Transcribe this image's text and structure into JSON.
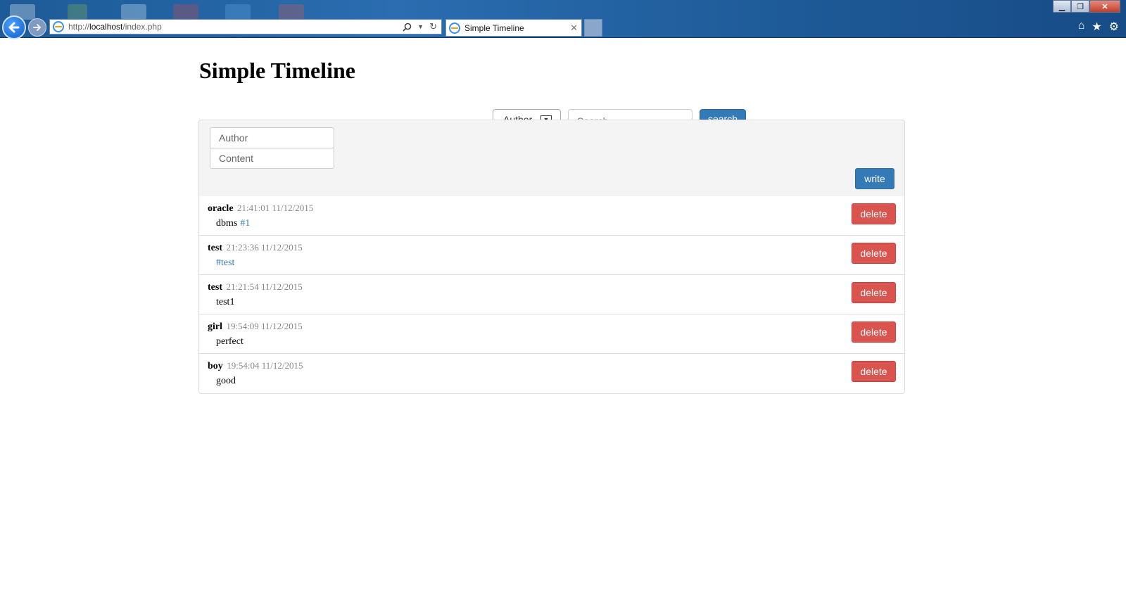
{
  "browser": {
    "url_prefix": "http://",
    "url_host": "localhost",
    "url_path": "/index.php",
    "tab_title": "Simple Timeline"
  },
  "page": {
    "title": "Simple Timeline"
  },
  "search": {
    "filter_selected": "Author",
    "placeholder": "Search",
    "button_label": "search"
  },
  "compose": {
    "author_placeholder": "Author",
    "content_placeholder": "Content",
    "write_label": "write"
  },
  "colors": {
    "primary": "#337ab7",
    "danger": "#d9534f",
    "panel_bg": "#f4f4f4",
    "meta_gray": "#888888"
  },
  "posts": [
    {
      "author": "oracle",
      "time": "21:41:01 11/12/2015",
      "text": "dbms",
      "tag": "#1",
      "delete_label": "delete"
    },
    {
      "author": "test",
      "time": "21:23:36 11/12/2015",
      "text": "",
      "tag": "#test",
      "delete_label": "delete"
    },
    {
      "author": "test",
      "time": "21:21:54 11/12/2015",
      "text": "test1",
      "tag": "",
      "delete_label": "delete"
    },
    {
      "author": "girl",
      "time": "19:54:09 11/12/2015",
      "text": "perfect",
      "tag": "",
      "delete_label": "delete"
    },
    {
      "author": "boy",
      "time": "19:54:04 11/12/2015",
      "text": "good",
      "tag": "",
      "delete_label": "delete"
    }
  ]
}
